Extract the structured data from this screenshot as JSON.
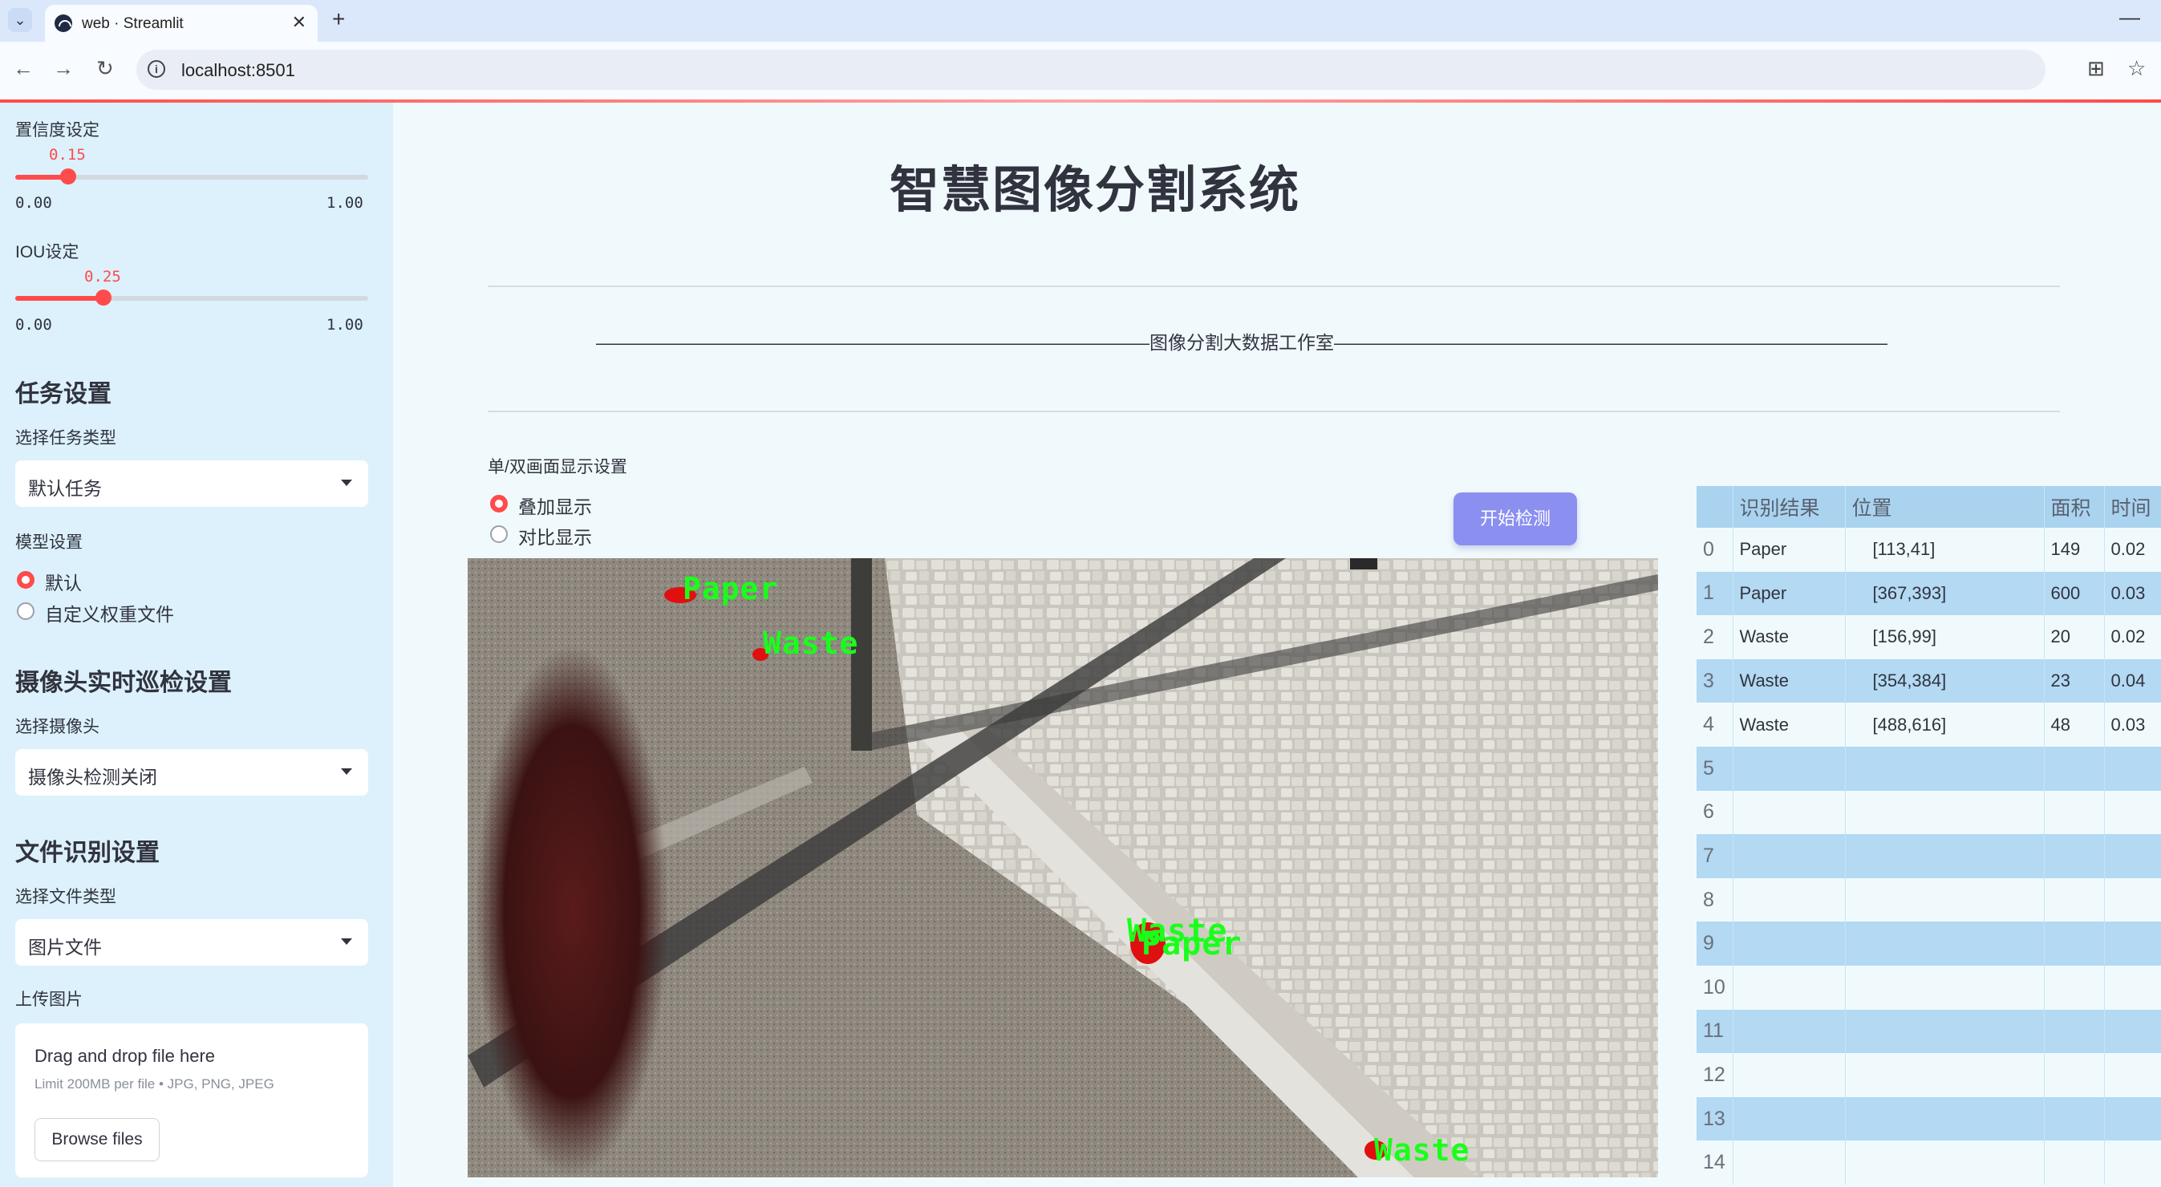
{
  "browser": {
    "tab_title": "web · Streamlit",
    "url": "localhost:8501"
  },
  "sidebar": {
    "conf_label": "置信度设定",
    "conf_value": "0.15",
    "conf_fraction": 0.15,
    "conf_min": "0.00",
    "conf_max": "1.00",
    "iou_label": "IOU设定",
    "iou_value": "0.25",
    "iou_fraction": 0.25,
    "iou_min": "0.00",
    "iou_max": "1.00",
    "task_heading": "任务设置",
    "task_type_label": "选择任务类型",
    "task_type_value": "默认任务",
    "model_label": "模型设置",
    "model_options": [
      "默认",
      "自定义权重文件"
    ],
    "model_selected": 0,
    "camera_heading": "摄像头实时巡检设置",
    "camera_label": "选择摄像头",
    "camera_value": "摄像头检测关闭",
    "file_heading": "文件识别设置",
    "file_type_label": "选择文件类型",
    "file_type_value": "图片文件",
    "upload_label": "上传图片",
    "upload_drag_text": "Drag and drop file here",
    "upload_limit_text": "Limit 200MB per file • JPG, PNG, JPEG",
    "browse_label": "Browse files"
  },
  "main": {
    "title": "智慧图像分割系统",
    "studio_line": "——————————————————————————————图像分割大数据工作室——————————————————————————————",
    "display_mode_label": "单/双画面显示设置",
    "display_options": [
      "叠加显示",
      "对比显示"
    ],
    "display_selected": 0,
    "start_button": "开始检测"
  },
  "detections_overlay": [
    {
      "label": "Paper"
    },
    {
      "label": "Waste"
    },
    {
      "label": "Waste"
    },
    {
      "label": "Paper"
    },
    {
      "label": "Waste"
    }
  ],
  "results_table": {
    "columns": [
      "",
      "识别结果",
      "位置",
      "面积",
      "时间"
    ],
    "rows": [
      [
        "0",
        "Paper",
        "[113,41]",
        "149",
        "0.02"
      ],
      [
        "1",
        "Paper",
        "[367,393]",
        "600",
        "0.03"
      ],
      [
        "2",
        "Waste",
        "[156,99]",
        "20",
        "0.02"
      ],
      [
        "3",
        "Waste",
        "[354,384]",
        "23",
        "0.04"
      ],
      [
        "4",
        "Waste",
        "[488,616]",
        "48",
        "0.03"
      ],
      [
        "5",
        "",
        "",
        "",
        ""
      ],
      [
        "6",
        "",
        "",
        "",
        ""
      ],
      [
        "7",
        "",
        "",
        "",
        ""
      ],
      [
        "8",
        "",
        "",
        "",
        ""
      ],
      [
        "9",
        "",
        "",
        "",
        ""
      ],
      [
        "10",
        "",
        "",
        "",
        ""
      ],
      [
        "11",
        "",
        "",
        "",
        ""
      ],
      [
        "12",
        "",
        "",
        "",
        ""
      ],
      [
        "13",
        "",
        "",
        "",
        ""
      ],
      [
        "14",
        "",
        "",
        "",
        ""
      ]
    ]
  },
  "colors": {
    "accent": "#ff4b4b",
    "sidebar_bg": "#dcf1fb",
    "main_bg": "#f0fafd",
    "button_bg": "#8b8ff0",
    "table_header_bg": "#a9d3ef",
    "table_stripe": "#b3d9f3",
    "detection_text": "#1aff1a",
    "detection_mask": "#e01010"
  }
}
